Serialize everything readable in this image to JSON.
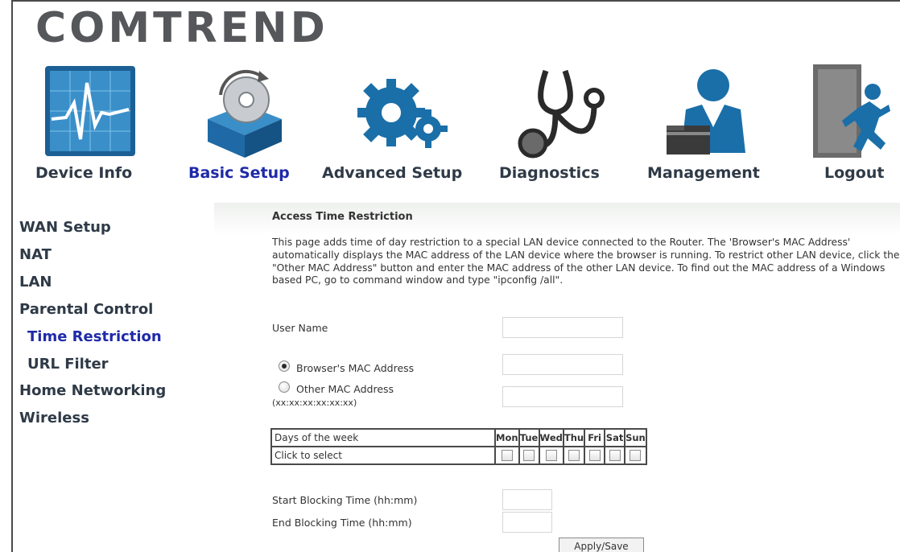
{
  "brand": {
    "logo_text": "COMTREND"
  },
  "nav": {
    "items": [
      {
        "label": "Device Info",
        "icon": "device-info-icon"
      },
      {
        "label": "Basic Setup",
        "icon": "basic-setup-icon",
        "active": true
      },
      {
        "label": "Advanced Setup",
        "icon": "advanced-setup-icon"
      },
      {
        "label": "Diagnostics",
        "icon": "diagnostics-icon"
      },
      {
        "label": "Management",
        "icon": "management-icon"
      },
      {
        "label": "Logout",
        "icon": "logout-icon"
      }
    ]
  },
  "sidebar": {
    "items": [
      {
        "label": "WAN Setup"
      },
      {
        "label": "NAT"
      },
      {
        "label": "LAN"
      },
      {
        "label": "Parental Control"
      },
      {
        "label": "Time Restriction",
        "active": true
      },
      {
        "label": "URL Filter"
      },
      {
        "label": "Home Networking"
      },
      {
        "label": "Wireless"
      }
    ]
  },
  "main": {
    "title": "Access Time Restriction",
    "description": "This page adds time of day restriction to a special LAN device connected to the Router. The 'Browser's MAC Address' automatically displays the MAC address of the LAN device where the browser is running. To restrict other LAN device, click the \"Other MAC Address\" button and enter the MAC address of the other LAN device. To find out the MAC address of a Windows based PC, go to command window and type \"ipconfig /all\".",
    "user_name_label": "User Name",
    "user_name_value": "",
    "browser_mac_label": "Browser's MAC Address",
    "browser_mac_value": "",
    "other_mac_label": "Other MAC Address",
    "other_mac_hint": "(xx:xx:xx:xx:xx:xx)",
    "other_mac_value": "",
    "days_header": "Days of the week",
    "click_to_select": "Click to select",
    "days": [
      "Mon",
      "Tue",
      "Wed",
      "Thu",
      "Fri",
      "Sat",
      "Sun"
    ],
    "start_label": "Start Blocking Time (hh:mm)",
    "start_value": "",
    "end_label": "End Blocking Time (hh:mm)",
    "end_value": "",
    "apply_label": "Apply/Save"
  },
  "colors": {
    "active_link": "#1f2aa8",
    "text": "#2f3a47",
    "icon_blue": "#1a6fa8"
  }
}
